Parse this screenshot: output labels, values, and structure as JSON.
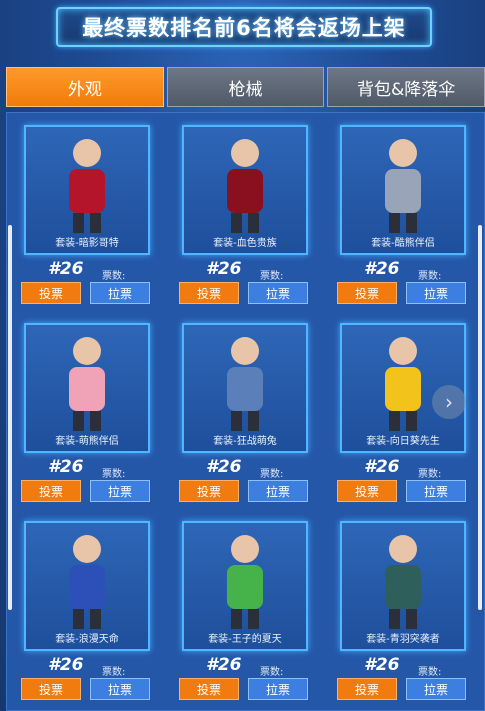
{
  "banner": {
    "title": "最终票数排名前6名将会返场上架"
  },
  "tabs": [
    {
      "label": "外观",
      "active": true
    },
    {
      "label": "枪械",
      "active": false
    },
    {
      "label": "背包&降落伞",
      "active": false
    }
  ],
  "vote_label": "投票",
  "pull_label": "拉票",
  "votes_label": "票数:",
  "items": [
    {
      "name": "套装-暗影哥特",
      "rank": "#26",
      "color": "#b5152a"
    },
    {
      "name": "套装-血色贵族",
      "rank": "#26",
      "color": "#8a1020"
    },
    {
      "name": "套装-酷熊伴侣",
      "rank": "#26",
      "color": "#9aa4b8"
    },
    {
      "name": "套装-萌熊伴侣",
      "rank": "#26",
      "color": "#f0a2b6"
    },
    {
      "name": "套装-狂战萌兔",
      "rank": "#26",
      "color": "#5b7fb8"
    },
    {
      "name": "套装-向日葵先生",
      "rank": "#26",
      "color": "#f2c31a"
    },
    {
      "name": "套装-浪漫天命",
      "rank": "#26",
      "color": "#2c4fb8"
    },
    {
      "name": "套装-王子的夏天",
      "rank": "#26",
      "color": "#45b34a"
    },
    {
      "name": "套装-青羽突袭者",
      "rank": "#26",
      "color": "#2f5f5a"
    }
  ],
  "icons": {
    "next": "chevron-right-icon"
  }
}
